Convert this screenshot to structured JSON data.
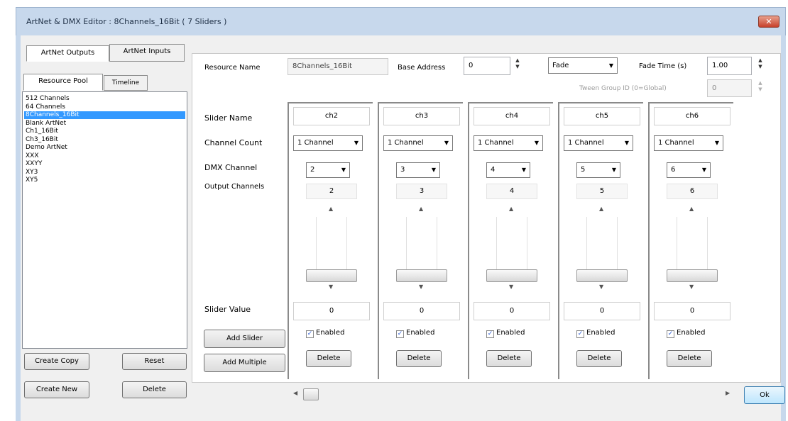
{
  "window": {
    "title": "ArtNet & DMX Editor : 8Channels_16Bit ( 7 Sliders )",
    "close_glyph": "✕"
  },
  "left": {
    "top_tabs": [
      "ArtNet Outputs",
      "ArtNet Inputs"
    ],
    "sub_tabs": [
      "Resource Pool",
      "Timeline"
    ],
    "list_items": [
      "512 Channels",
      "64 Channels",
      "8Channels_16Bit",
      "Blank ArtNet",
      "Ch1_16Bit",
      "Ch3_16Bit",
      "Demo ArtNet",
      "XXX",
      "XXYY",
      "XY3",
      "XY5"
    ],
    "selected_index": 2,
    "buttons": {
      "create_copy": "Create Copy",
      "reset": "Reset",
      "create_new": "Create New",
      "delete": "Delete"
    }
  },
  "header": {
    "resource_name_label": "Resource Name",
    "resource_name_value": "8Channels_16Bit",
    "base_address_label": "Base Address",
    "base_address_value": "0",
    "mode_value": "Fade",
    "fade_time_label": "Fade Time (s)",
    "fade_time_value": "1.00",
    "tween_label": "Tween Group ID (0=Global)",
    "tween_value": "0"
  },
  "row_labels": {
    "slider_name": "Slider Name",
    "channel_count": "Channel Count",
    "dmx_channel": "DMX Channel",
    "output_channels": "Output Channels",
    "slider_value": "Slider Value"
  },
  "actions": {
    "add_slider": "Add Slider",
    "add_multiple": "Add Multiple"
  },
  "sliders": [
    {
      "name": "ch2",
      "channel_count": "1 Channel",
      "dmx_channel": "2",
      "output_channels": "2",
      "value": "0",
      "enabled_label": "Enabled",
      "enabled": true,
      "delete_label": "Delete"
    },
    {
      "name": "ch3",
      "channel_count": "1 Channel",
      "dmx_channel": "3",
      "output_channels": "3",
      "value": "0",
      "enabled_label": "Enabled",
      "enabled": true,
      "delete_label": "Delete"
    },
    {
      "name": "ch4",
      "channel_count": "1 Channel",
      "dmx_channel": "4",
      "output_channels": "4",
      "value": "0",
      "enabled_label": "Enabled",
      "enabled": true,
      "delete_label": "Delete"
    },
    {
      "name": "ch5",
      "channel_count": "1 Channel",
      "dmx_channel": "5",
      "output_channels": "5",
      "value": "0",
      "enabled_label": "Enabled",
      "enabled": true,
      "delete_label": "Delete"
    },
    {
      "name": "ch6",
      "channel_count": "1 Channel",
      "dmx_channel": "6",
      "output_channels": "6",
      "value": "0",
      "enabled_label": "Enabled",
      "enabled": true,
      "delete_label": "Delete"
    }
  ],
  "footer": {
    "ok_label": "Ok"
  }
}
